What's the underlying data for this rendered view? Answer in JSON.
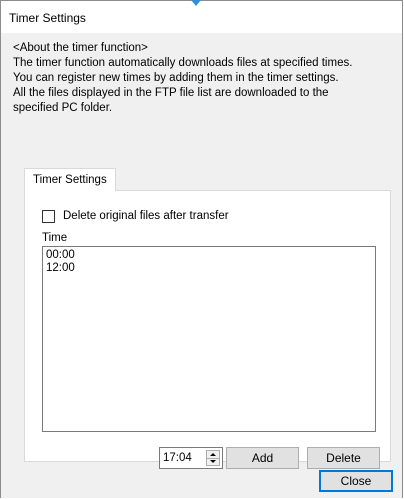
{
  "window": {
    "title": "Timer Settings"
  },
  "about": {
    "lines": [
      "<About the timer function>",
      "The timer function automatically downloads files at specified times.",
      "You can register new times by adding them in the timer settings.",
      "All the files displayed in the FTP file list are downloaded to the",
      "specified PC folder."
    ]
  },
  "tabs": [
    {
      "label": "Timer Settings",
      "active": true
    }
  ],
  "options": {
    "delete_original_label": "Delete original files after transfer",
    "delete_original_checked": false
  },
  "time_list": {
    "label": "Time",
    "items": [
      "00:00",
      "12:00"
    ]
  },
  "time_input": {
    "value": "17:04"
  },
  "buttons": {
    "add": "Add",
    "delete": "Delete",
    "close": "Close"
  },
  "colors": {
    "accent": "#0078d7",
    "marker": "#2f8fde",
    "dialog_bg": "#f0f0f0"
  }
}
